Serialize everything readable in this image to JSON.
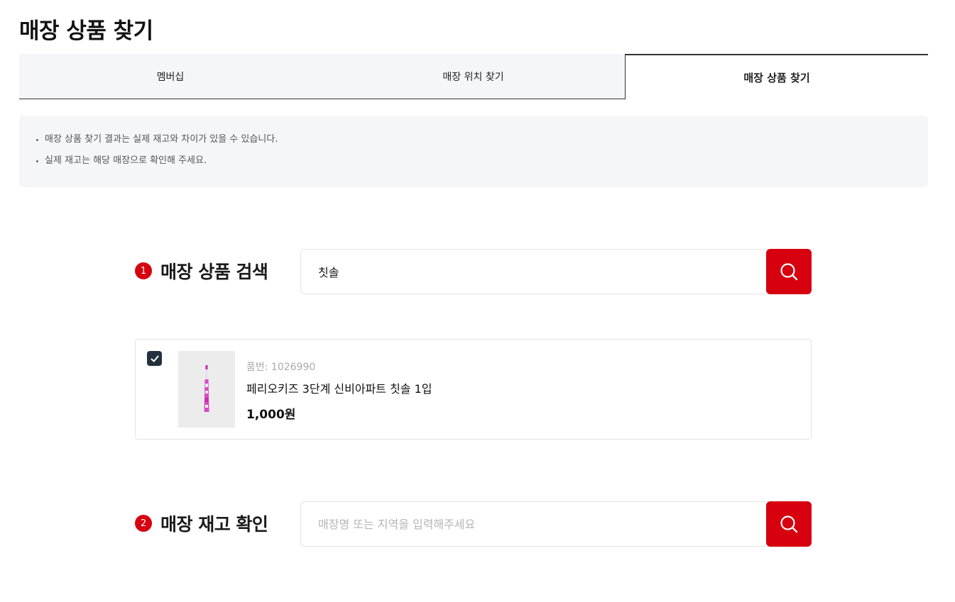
{
  "page_title": "매장 상품 찾기",
  "tabs": [
    {
      "label": "멤버십",
      "active": false
    },
    {
      "label": "매장 위치 찾기",
      "active": false
    },
    {
      "label": "매장 상품 찾기",
      "active": true
    }
  ],
  "notice": [
    "매장 상품 찾기 결과는 실제 재고와 차이가 있을 수 있습니다.",
    "실제 재고는 해당 매장으로 확인해 주세요."
  ],
  "step1": {
    "number": "1",
    "label": "매장 상품 검색",
    "input_value": "칫솔",
    "button_icon": "search-icon"
  },
  "product": {
    "checked": true,
    "code": "품번: 1026990",
    "name": "페리오키즈 3단계 신비아파트 칫솔 1입",
    "price": "1,000원"
  },
  "step2": {
    "number": "2",
    "label": "매장 재고 확인",
    "input_placeholder": "매장명 또는 지역을 입력해주세요",
    "button_icon": "search-icon"
  },
  "colors": {
    "accent": "#d6000f",
    "checkbox": "#24303d",
    "panel_bg": "#f5f6f8"
  }
}
